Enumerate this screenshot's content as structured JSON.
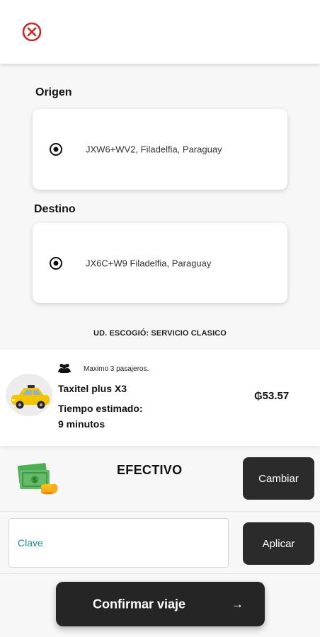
{
  "header": {
    "close_icon": "close-circle-icon"
  },
  "origin": {
    "label": "Origen",
    "address": "JXW6+WV2, Filadelfia, Paraguay"
  },
  "destination": {
    "label": "Destino",
    "address": "JX6C+W9 Filadelfia, Paraguay"
  },
  "service_note": "UD. ESCOGIÓ: SERVICIO CLASICO",
  "ride": {
    "passengers_text": "Maximo 3 pasajeros.",
    "car_name": "Taxitel plus X3",
    "eta_label": "Tiempo estimado:",
    "eta_value": "9 minutos",
    "price": "₲53.57"
  },
  "payment": {
    "method": "EFECTIVO",
    "change_label": "Cambiar"
  },
  "promo": {
    "placeholder": "Clave",
    "apply_label": "Aplicar"
  },
  "confirm": {
    "label": "Confirmar viaje",
    "arrow": "→"
  },
  "colors": {
    "close_red": "#c62828",
    "dark_button": "#2b2b2b",
    "placeholder_teal": "#1e8b9a",
    "taxi_yellow": "#f5c400"
  }
}
